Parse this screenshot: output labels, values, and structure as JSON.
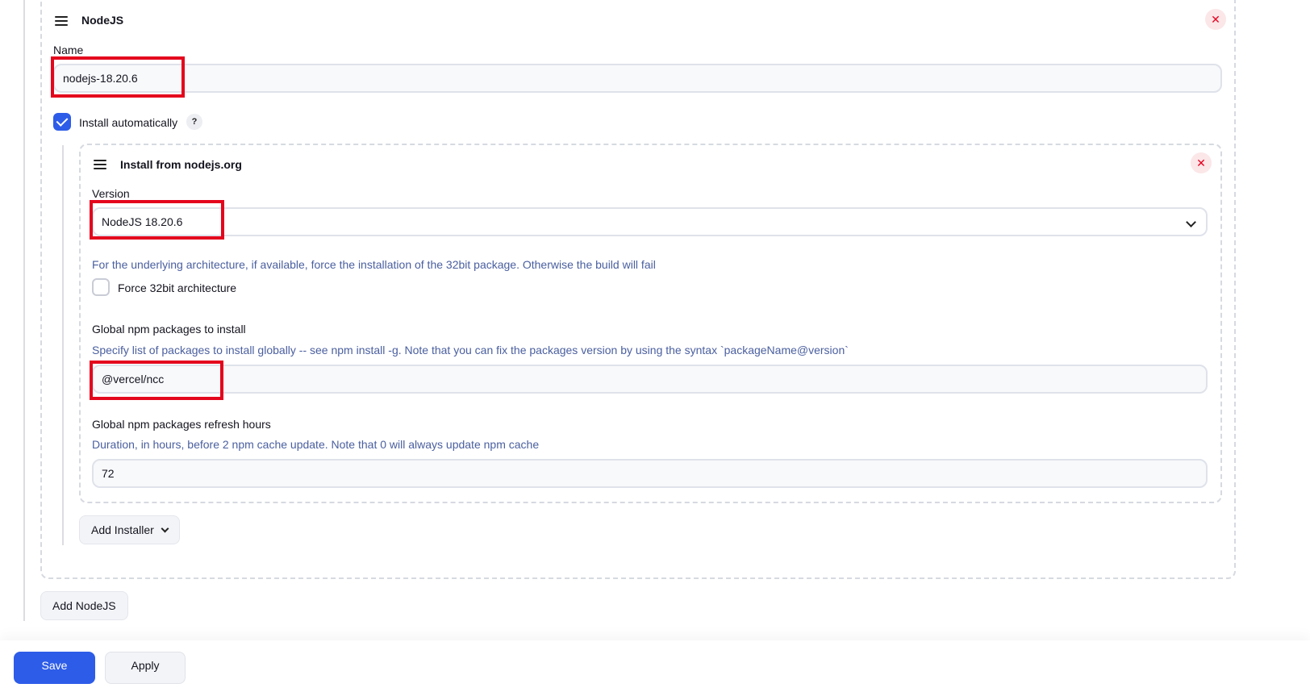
{
  "nodejs_card": {
    "title": "NodeJS",
    "close_icon": "close-icon",
    "name_label": "Name",
    "name_value": "nodejs-18.20.6",
    "install_auto_label": "Install automatically",
    "install_auto_checked": true,
    "help_icon": "?"
  },
  "installer_card": {
    "title": "Install from nodejs.org",
    "version_label": "Version",
    "version_value": "NodeJS 18.20.6",
    "arch_help": "For the underlying architecture, if available, force the installation of the 32bit package. Otherwise the build will fail",
    "force32_label": "Force 32bit architecture",
    "force32_checked": false,
    "npm_label": "Global npm packages to install",
    "npm_help": "Specify list of packages to install globally -- see npm install -g. Note that you can fix the packages version by using the syntax `packageName@version`",
    "npm_value": "@vercel/ncc",
    "refresh_label": "Global npm packages refresh hours",
    "refresh_help": "Duration, in hours, before 2 npm cache update. Note that 0 will always update npm cache",
    "refresh_value": "72"
  },
  "add_installer_label": "Add Installer",
  "add_nodejs_label": "Add NodeJS",
  "footer": {
    "save_label": "Save",
    "apply_label": "Apply"
  },
  "colors": {
    "accent": "#2d5ce8",
    "highlight": "#e4061d",
    "help_text": "#4a5f9f"
  }
}
